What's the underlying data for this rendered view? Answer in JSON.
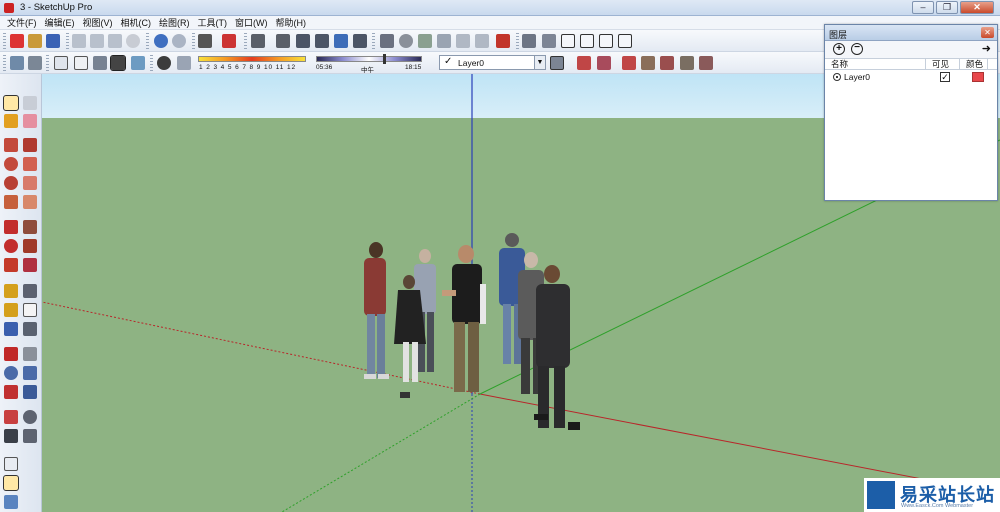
{
  "window": {
    "title": "3 - SketchUp Pro",
    "buttons": {
      "minimize": "–",
      "maximize": "❐",
      "close": "✕"
    }
  },
  "menu": [
    "文件(F)",
    "编辑(E)",
    "视图(V)",
    "相机(C)",
    "绘图(R)",
    "工具(T)",
    "窗口(W)",
    "帮助(H)"
  ],
  "shadow_settings": {
    "months_labels": "1 2 3 4 5 6 7 8 9 10 11 12",
    "time_start": "05:36",
    "time_mid": "中午",
    "time_end": "18:15",
    "time_fraction": 0.63
  },
  "layer_toolbar": {
    "current_layer": "Layer0",
    "check": "✓",
    "arrow": "▼"
  },
  "layers_panel": {
    "title": "图层",
    "close": "✕",
    "add": "+",
    "remove": "−",
    "details": "➜",
    "columns": [
      "名称",
      "可见",
      "颜色"
    ],
    "layers": [
      {
        "name": "Layer0",
        "visible_mark": "✓",
        "active": true,
        "color": "#e8474b"
      }
    ]
  },
  "viewport": {
    "sky_color": "#c9e8f6",
    "ground_color": "#8eb383",
    "axis_colors": {
      "red": "#b8262a",
      "green": "#2ea02a",
      "blue": "#2a3fb8"
    },
    "people_count": 8
  },
  "watermark": {
    "logo_text": "易采站长站",
    "sub_text": "Www.Easck.Com  Webmaster"
  }
}
